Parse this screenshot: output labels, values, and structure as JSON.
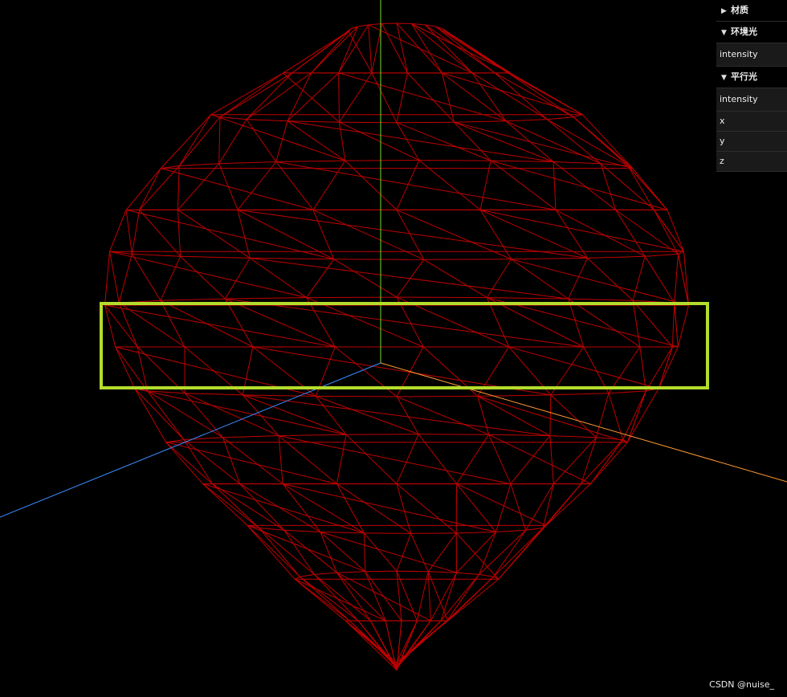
{
  "gui": {
    "folders": [
      {
        "title": "材质",
        "expanded": false
      },
      {
        "title": "环境光",
        "expanded": true,
        "controls": [
          "intensity"
        ]
      },
      {
        "title": "平行光",
        "expanded": true,
        "controls": [
          "intensity",
          "x",
          "y",
          "z"
        ]
      }
    ]
  },
  "watermark": "CSDN @nuise_",
  "colors": {
    "background": "#000000",
    "wireframe": "#c00000",
    "highlight_box": "#b4dc2c",
    "axis_y": "#7bdc2c",
    "axis_z": "#3a8cff",
    "axis_x": "#ff9a30"
  },
  "icons": {
    "collapsed": "chevron-right-icon",
    "expanded": "chevron-down-icon"
  }
}
